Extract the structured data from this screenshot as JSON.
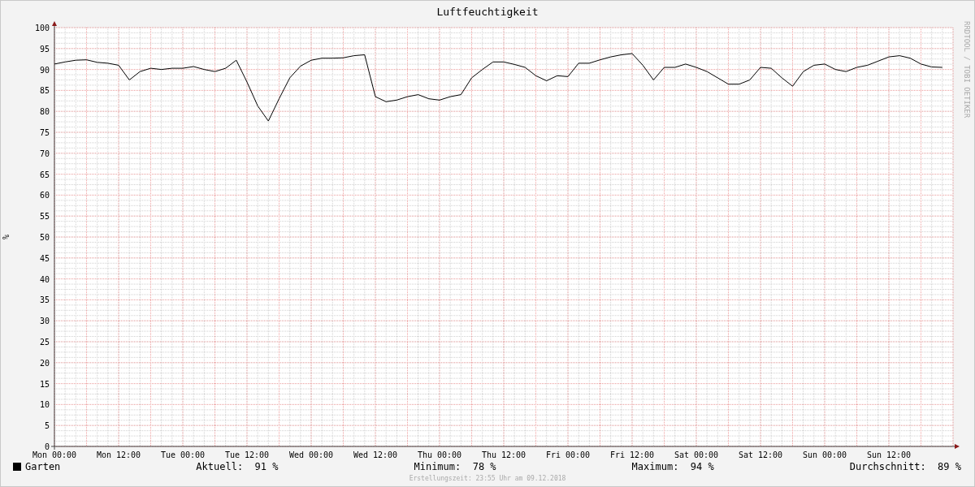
{
  "title": "Luftfeuchtigkeit",
  "vertical_label": "RRDTOOL / TOBI OETIKER",
  "chart_data": {
    "type": "line",
    "grid": true,
    "ylabel": "%",
    "ylim": [
      0,
      100
    ],
    "yticks": [
      0,
      5,
      10,
      15,
      20,
      25,
      30,
      35,
      40,
      45,
      50,
      55,
      60,
      65,
      70,
      75,
      80,
      85,
      90,
      95,
      100
    ],
    "categories": [
      "Mon 00:00",
      null,
      null,
      null,
      null,
      null,
      "Mon 12:00",
      null,
      null,
      null,
      null,
      null,
      "Tue 00:00",
      null,
      null,
      null,
      null,
      null,
      "Tue 12:00",
      null,
      null,
      null,
      null,
      null,
      "Wed 00:00",
      null,
      null,
      null,
      null,
      null,
      "Wed 12:00",
      null,
      null,
      null,
      null,
      null,
      "Thu 00:00",
      null,
      null,
      null,
      null,
      null,
      "Thu 12:00",
      null,
      null,
      null,
      null,
      null,
      "Fri 00:00",
      null,
      null,
      null,
      null,
      null,
      "Fri 12:00",
      null,
      null,
      null,
      null,
      null,
      "Sat 00:00",
      null,
      null,
      null,
      null,
      null,
      "Sat 12:00",
      null,
      null,
      null,
      null,
      null,
      "Sun 00:00",
      null,
      null,
      null,
      null,
      null,
      "Sun 12:00",
      null,
      null,
      null,
      null,
      null
    ],
    "series": [
      {
        "name": "Garten",
        "color": "#000000",
        "values": [
          91.3,
          91.8,
          92.2,
          92.3,
          91.7,
          91.5,
          91,
          87.5,
          89.5,
          90.3,
          90,
          90.3,
          90.3,
          90.7,
          90,
          89.5,
          90.3,
          92.2,
          87,
          81.3,
          77.7,
          83,
          88,
          90.8,
          92.2,
          92.7,
          92.7,
          92.8,
          93.3,
          93.5,
          83.5,
          82.3,
          82.7,
          83.5,
          84,
          83,
          82.7,
          83.5,
          84,
          88,
          90,
          91.8,
          91.8,
          91.2,
          90.5,
          88.5,
          87.3,
          88.5,
          88.3,
          91.5,
          91.5,
          92.3,
          93,
          93.5,
          93.8,
          91,
          87.5,
          90.5,
          90.5,
          91.3,
          90.5,
          89.5,
          88,
          86.5,
          86.5,
          87.5,
          90.5,
          90.3,
          88,
          86,
          89.5,
          91,
          91.3,
          90,
          89.5,
          90.5,
          91,
          92,
          93,
          93.3,
          92.7,
          91.3,
          90.6,
          90.5
        ]
      }
    ]
  },
  "legend": [
    {
      "label": "Aktuell:",
      "value": "91 %"
    },
    {
      "label": "Minimum:",
      "value": "78 %"
    },
    {
      "label": "Maximum:",
      "value": "94 %"
    },
    {
      "label": "Durchschnitt:",
      "value": "89 %"
    }
  ],
  "footer": "Erstellungszeit: 23:55 Uhr am 09.12.2018"
}
